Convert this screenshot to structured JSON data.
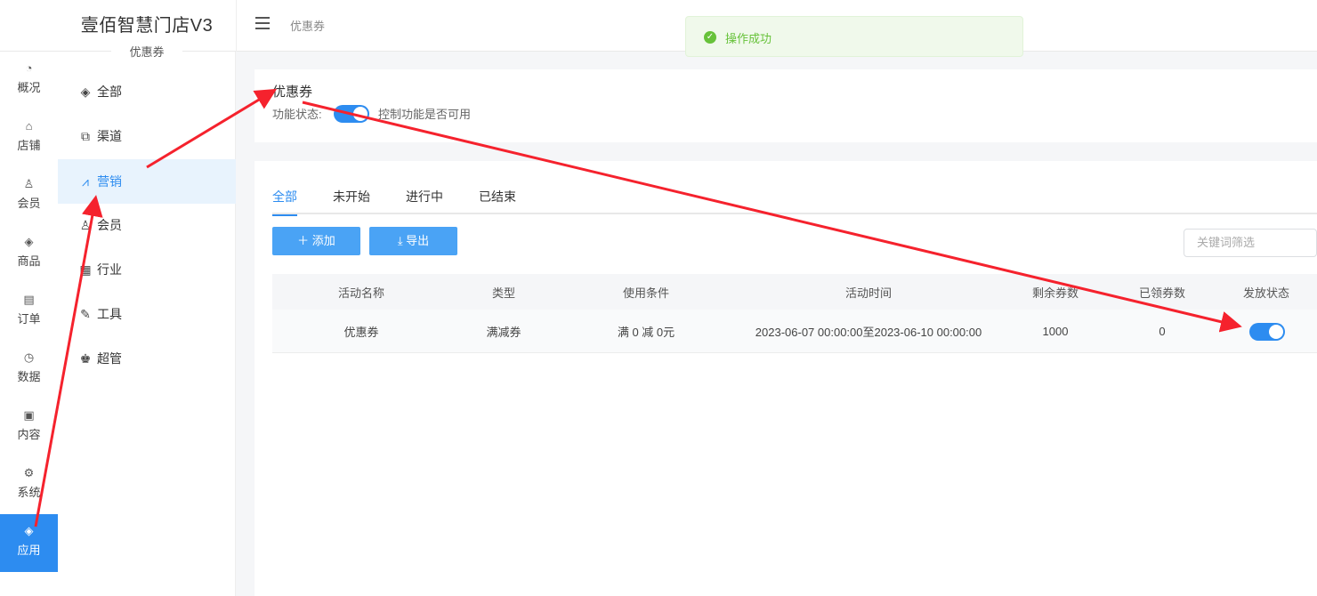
{
  "header": {
    "brand_title": "壹佰智慧门店V3",
    "brand_sub": "优惠券",
    "breadcrumb": "优惠券"
  },
  "toast": {
    "text": "操作成功",
    "color": "#67c23a"
  },
  "rail": {
    "items": [
      {
        "label": "概况",
        "icon": "dashboard-icon"
      },
      {
        "label": "店铺",
        "icon": "shop-icon"
      },
      {
        "label": "会员",
        "icon": "user-icon"
      },
      {
        "label": "商品",
        "icon": "cube-icon"
      },
      {
        "label": "订单",
        "icon": "clipboard-icon"
      },
      {
        "label": "数据",
        "icon": "pie-chart-icon"
      },
      {
        "label": "内容",
        "icon": "folder-icon"
      },
      {
        "label": "系统",
        "icon": "gear-icon"
      },
      {
        "label": "应用",
        "icon": "cube-icon",
        "active": true
      }
    ]
  },
  "subnav": {
    "items": [
      {
        "label": "全部",
        "icon": "cube-icon"
      },
      {
        "label": "渠道",
        "icon": "channel-icon"
      },
      {
        "label": "营销",
        "icon": "chart-icon",
        "active": true
      },
      {
        "label": "会员",
        "icon": "user-icon"
      },
      {
        "label": "行业",
        "icon": "calendar-icon"
      },
      {
        "label": "工具",
        "icon": "wrench-icon"
      },
      {
        "label": "超管",
        "icon": "admin-icon"
      }
    ]
  },
  "feature": {
    "title": "优惠券",
    "label": "功能状态:",
    "enabled": true,
    "hint": "控制功能是否可用"
  },
  "tabs": [
    {
      "label": "全部",
      "active": true
    },
    {
      "label": "未开始"
    },
    {
      "label": "进行中"
    },
    {
      "label": "已结束"
    }
  ],
  "actions": {
    "add_label": "添加",
    "export_label": "导出",
    "search_placeholder": "关键词筛选"
  },
  "table": {
    "columns": [
      "活动名称",
      "类型",
      "使用条件",
      "活动时间",
      "剩余券数",
      "已领券数",
      "发放状态"
    ],
    "rows": [
      {
        "name": "优惠券",
        "type": "满减券",
        "condition": "满 0 减 0元",
        "time": "2023-06-07 00:00:00至2023-06-10 00:00:00",
        "remaining": "1000",
        "claimed": "0",
        "status_on": true
      }
    ]
  },
  "colors": {
    "accent": "#2d8cf0",
    "arrow": "#f5222d"
  }
}
